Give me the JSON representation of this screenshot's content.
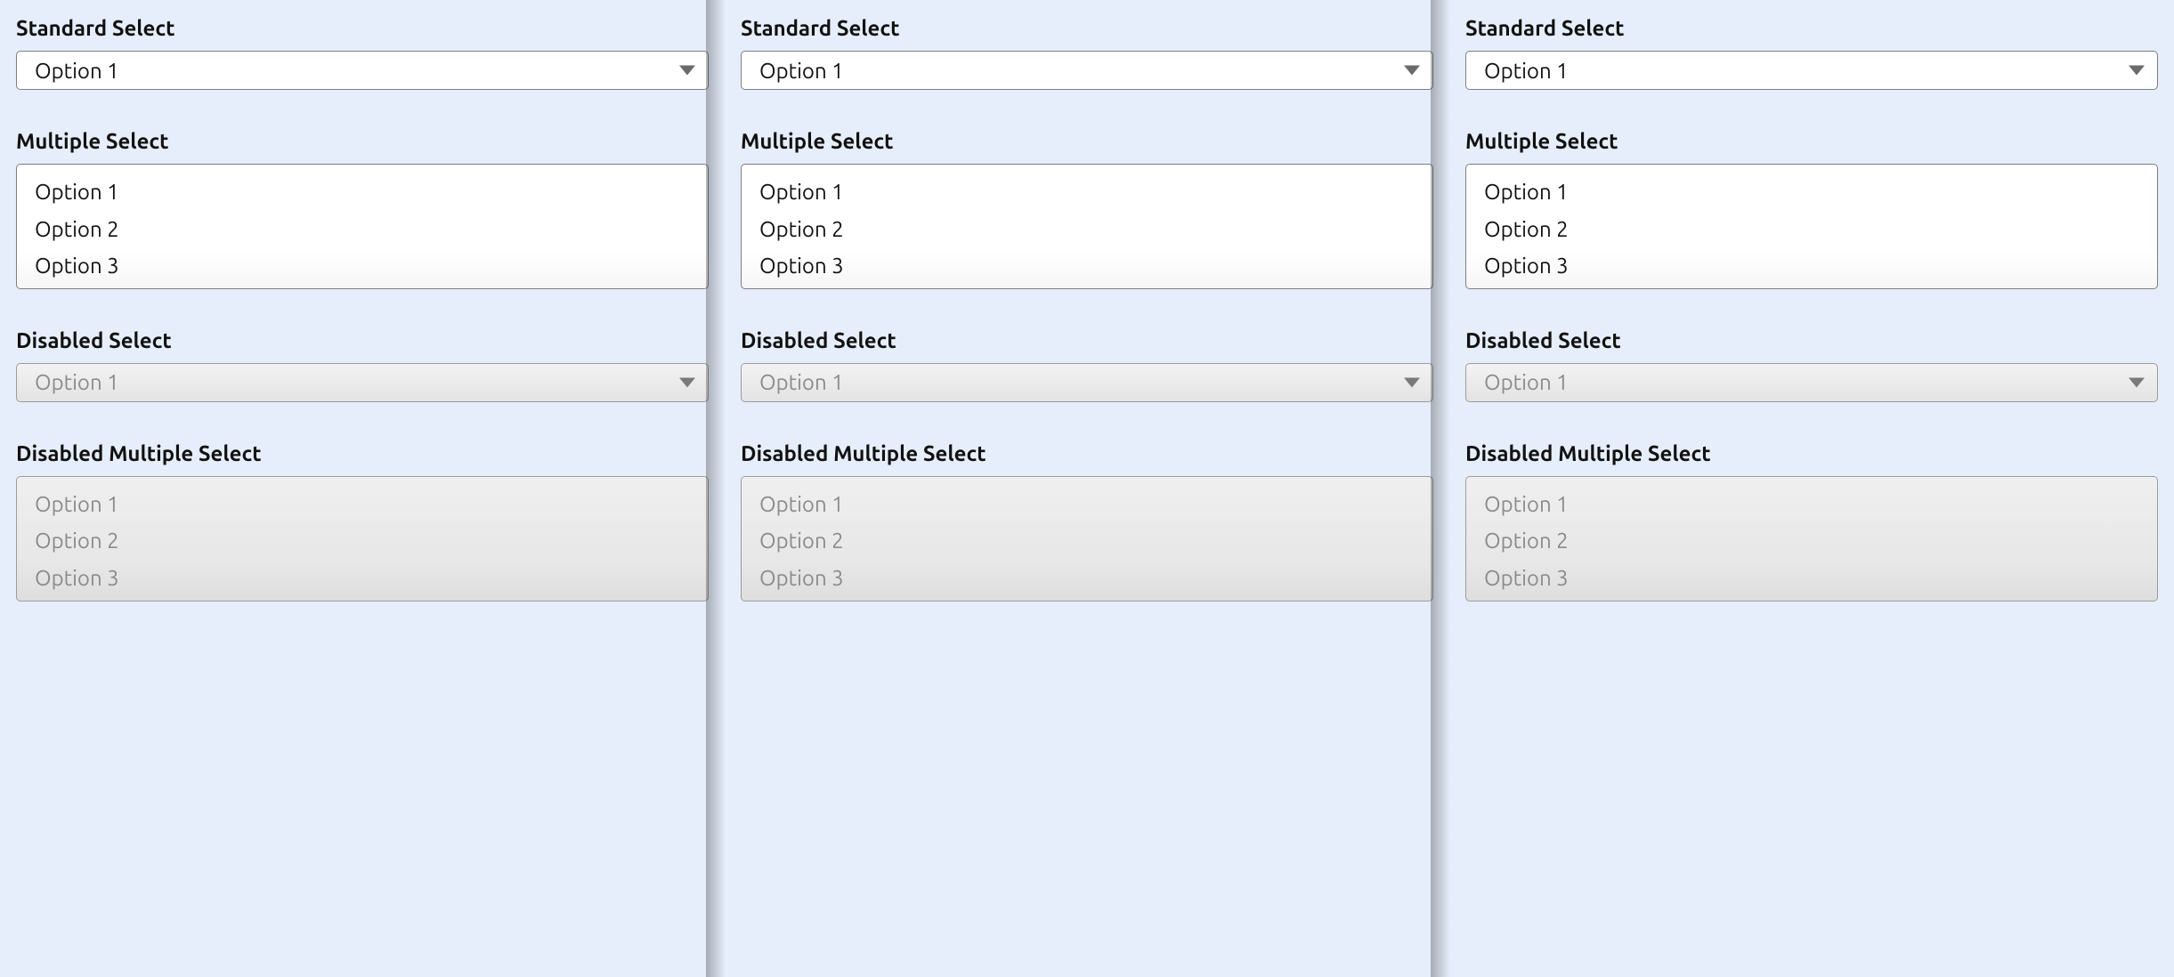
{
  "labels": {
    "standard": "Standard Select",
    "multiple": "Multiple Select",
    "disabled": "Disabled Select",
    "disabled_multiple": "Disabled Multiple Select"
  },
  "options": {
    "o1": "Option 1",
    "o2": "Option 2",
    "o3": "Option 3"
  },
  "selected": {
    "standard": "Option 1",
    "disabled": "Option 1"
  }
}
